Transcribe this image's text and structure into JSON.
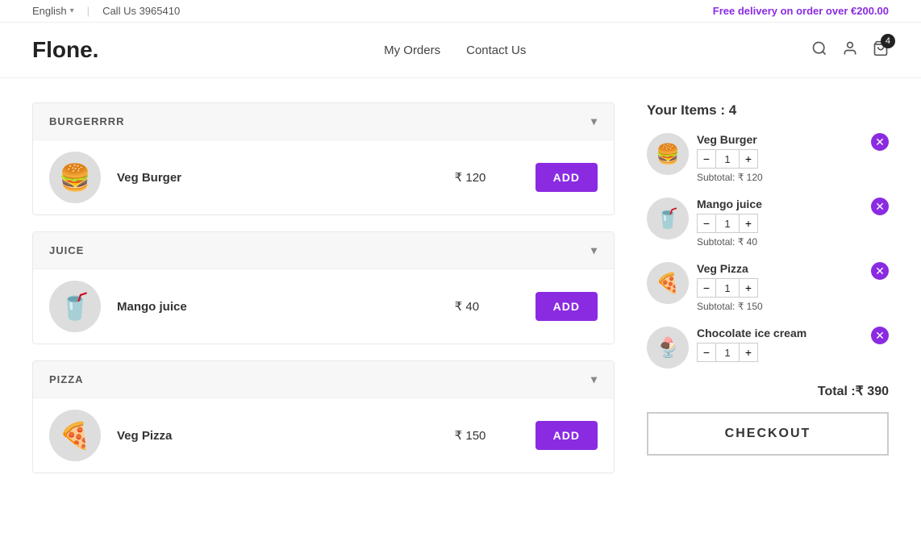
{
  "topbar": {
    "language": "English",
    "call_label": "Call Us 3965410",
    "delivery_text": "Free delivery on order over ",
    "delivery_amount": "€200.00"
  },
  "header": {
    "logo": "Flone.",
    "nav": [
      {
        "label": "My Orders",
        "id": "my-orders"
      },
      {
        "label": "Contact Us",
        "id": "contact-us"
      }
    ],
    "cart_count": "4"
  },
  "categories": [
    {
      "id": "burgerrrr",
      "label": "BURGERRRR",
      "items": [
        {
          "name": "Veg Burger",
          "price": "₹ 120",
          "icon": "🍔"
        }
      ]
    },
    {
      "id": "juice",
      "label": "JUICE",
      "items": [
        {
          "name": "Mango juice",
          "price": "₹ 40",
          "icon": "🥤"
        }
      ]
    },
    {
      "id": "pizza",
      "label": "PIZZA",
      "items": [
        {
          "name": "Veg Pizza",
          "price": "₹ 150",
          "icon": "🍕"
        }
      ]
    }
  ],
  "cart": {
    "title": "Your Items : 4",
    "items": [
      {
        "name": "Veg Burger",
        "qty": 1,
        "subtotal": "Subtotal: ₹ 120",
        "icon": "🍔"
      },
      {
        "name": "Mango juice",
        "qty": 1,
        "subtotal": "Subtotal: ₹ 40",
        "icon": "🥤"
      },
      {
        "name": "Veg Pizza",
        "qty": 1,
        "subtotal": "Subtotal: ₹ 150",
        "icon": "🍕"
      },
      {
        "name": "Chocolate ice cream",
        "qty": 1,
        "subtotal": "",
        "icon": "🍨"
      }
    ],
    "total_label": "Total :₹ 390",
    "checkout_label": "CHECKOUT"
  },
  "buttons": {
    "add_label": "ADD"
  }
}
